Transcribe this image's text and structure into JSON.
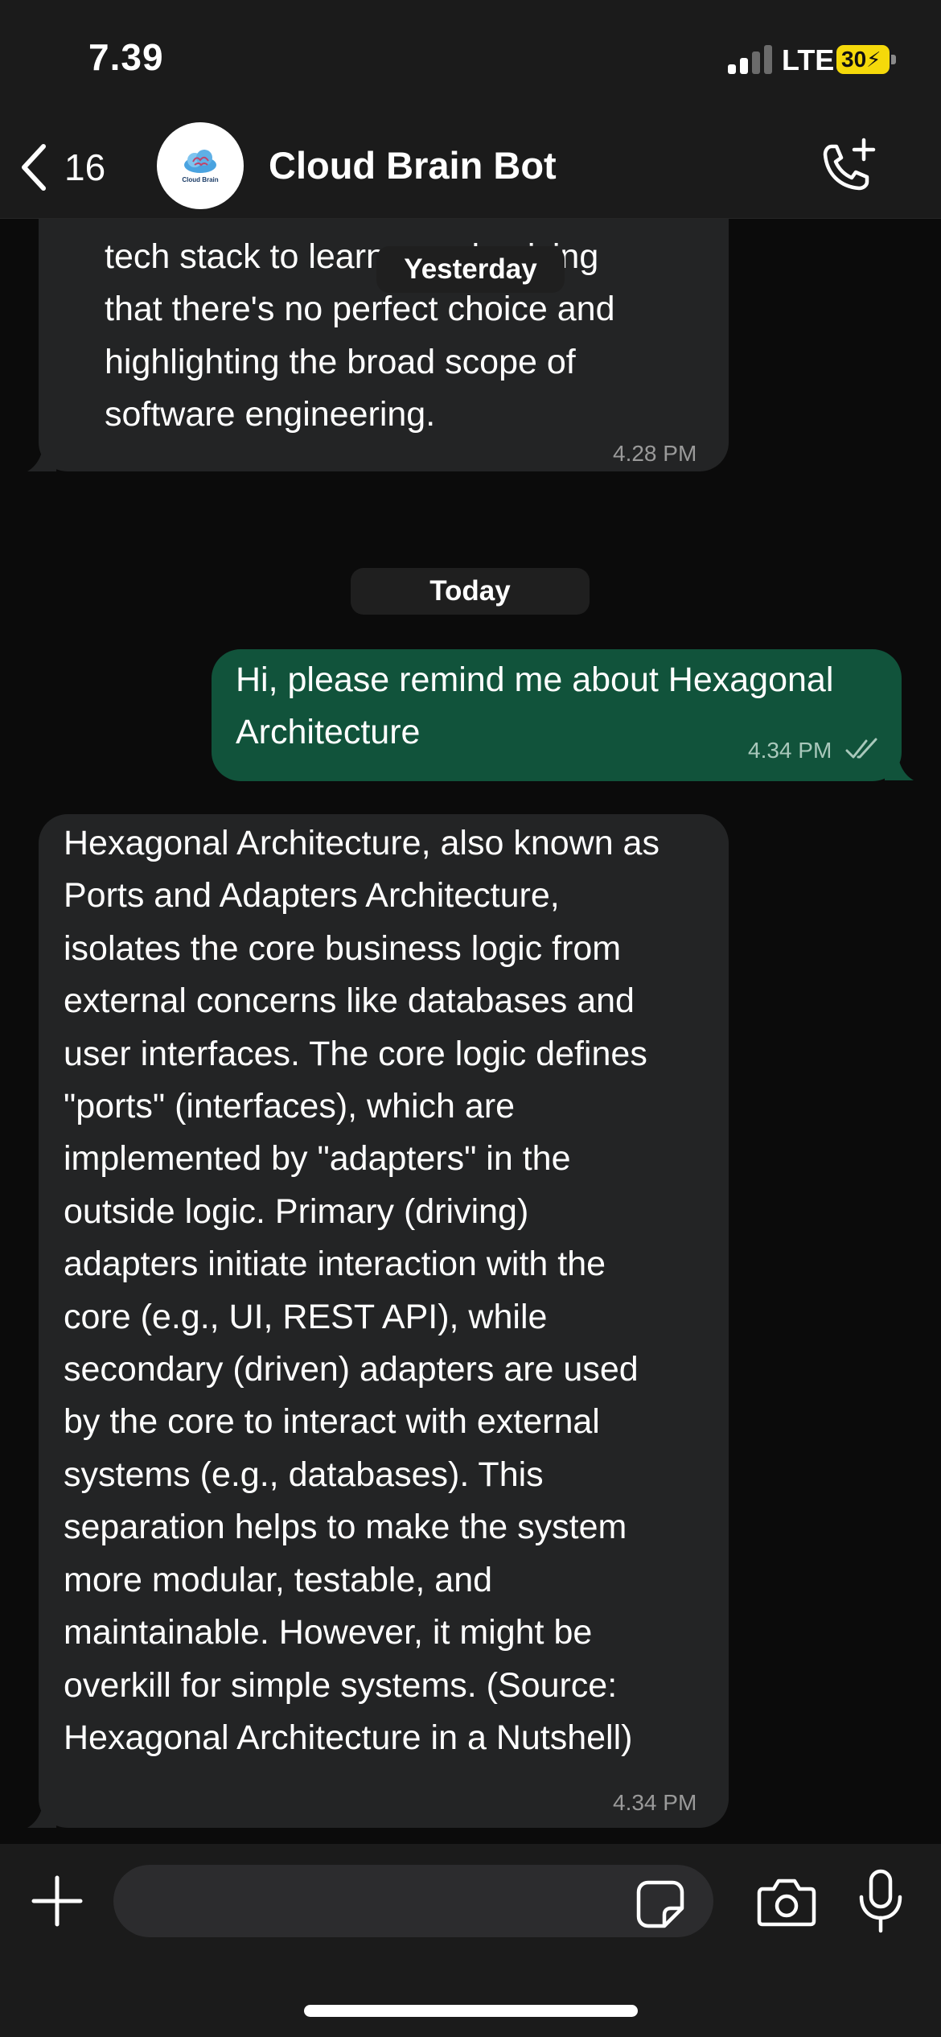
{
  "status_bar": {
    "time": "7.39",
    "network": "LTE",
    "battery": "30"
  },
  "header": {
    "back_count": "16",
    "title": "Cloud Brain Bot",
    "avatar_text": "Cloud Brain"
  },
  "date_chips": {
    "yesterday": "Yesterday",
    "today": "Today"
  },
  "messages": [
    {
      "direction": "incoming",
      "text": "tech stack to learn, emphasizing\nthat there's no perfect choice and\nhighlighting the broad scope of\nsoftware engineering.",
      "time": "4.28 PM"
    },
    {
      "direction": "outgoing",
      "text": "Hi, please remind me about Hexagonal\nArchitecture",
      "time": "4.34 PM",
      "status": "read"
    },
    {
      "direction": "incoming",
      "text": "Hexagonal Architecture, also known as\nPorts and Adapters Architecture,\nisolates the core business logic from\nexternal concerns like databases and\nuser interfaces.  The core logic defines\n\"ports\" (interfaces), which are\nimplemented by \"adapters\" in the\noutside logic.  Primary (driving)\nadapters initiate interaction with the\ncore (e.g., UI, REST API), while\nsecondary (driven) adapters are used\nby the core to interact with external\nsystems (e.g., databases). This\nseparation helps to make the system\nmore modular, testable, and\nmaintainable.  However, it might be\noverkill for simple systems. (Source:\nHexagonal Architecture in a Nutshell)",
      "time": "4.34 PM"
    }
  ],
  "composer": {
    "value": "",
    "placeholder": ""
  },
  "icons": {
    "back": "chevron-left-icon",
    "call": "phone-plus-icon",
    "plus": "plus-icon",
    "sticker": "sticker-icon",
    "camera": "camera-icon",
    "mic": "microphone-icon",
    "read_receipt": "double-check-icon"
  },
  "colors": {
    "background": "#0b0b0b",
    "bar": "#1b1b1b",
    "incoming_bubble": "#232425",
    "outgoing_bubble": "#11533b",
    "battery": "#f5d90a"
  }
}
